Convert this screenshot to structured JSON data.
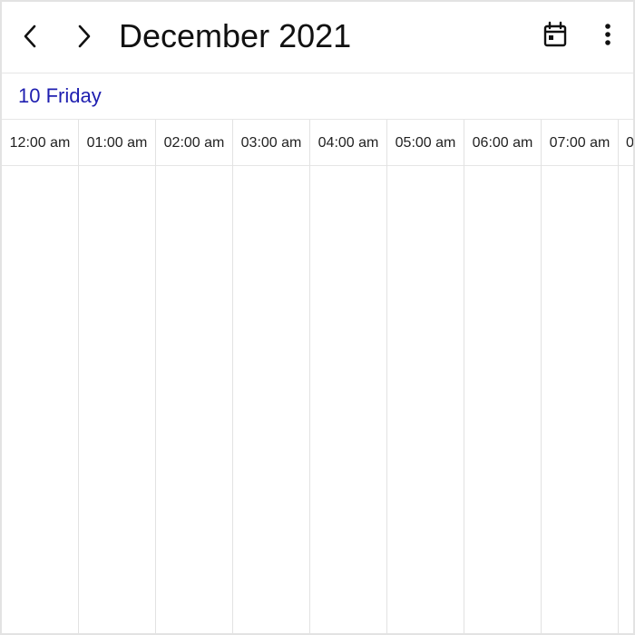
{
  "header": {
    "title": "December 2021",
    "prev_icon": "chevron-left-icon",
    "next_icon": "chevron-right-icon",
    "today_icon": "calendar-icon",
    "more_icon": "more-vertical-icon"
  },
  "day": {
    "label": "10 Friday",
    "color": "#1f1fb0"
  },
  "timeline": {
    "slots": [
      "12:00 am",
      "01:00 am",
      "02:00 am",
      "03:00 am",
      "04:00 am",
      "05:00 am",
      "06:00 am",
      "07:00 am",
      "0"
    ]
  },
  "colors": {
    "grid": "#e2e2e2",
    "text": "#111111"
  }
}
